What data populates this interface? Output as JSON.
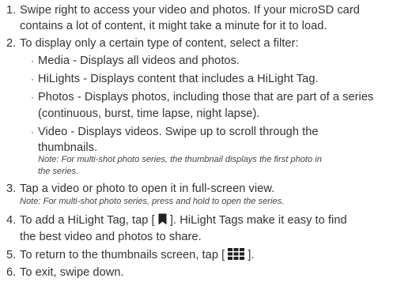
{
  "steps": [
    {
      "num": "1.",
      "lines": [
        "Swipe right to access your video and photos. If your microSD card",
        "contains a lot of content, it might take a minute for it to load."
      ]
    },
    {
      "num": "2.",
      "lines": [
        "To display only a certain type of content, select a filter:"
      ],
      "filters": [
        {
          "lines": [
            "Media - Displays all videos and photos."
          ]
        },
        {
          "lines": [
            "HiLights - Displays content that includes a HiLight Tag."
          ]
        },
        {
          "lines": [
            "Photos - Displays photos, including those that are part of a series",
            "(continuous, burst, time lapse, night lapse)."
          ]
        },
        {
          "lines": [
            "Video - Displays videos. Swipe up to scroll through the",
            "thumbnails."
          ],
          "note": [
            "Note: For multi-shot photo series, the thumbnail displays the first photo in",
            "the series."
          ]
        }
      ]
    },
    {
      "num": "3.",
      "lines": [
        "Tap a video or photo to open it in full-screen view."
      ],
      "note": [
        "Note: For multi-shot photo series, press and hold to open the series."
      ]
    },
    {
      "num": "4.",
      "line1_before": "To add a HiLight Tag, tap [",
      "line1_after": "]. HiLight Tags make it easy to find",
      "line2": "the best video and photos to share.",
      "icon": "hilight-tag-icon"
    },
    {
      "num": "5.",
      "line1_before": "To return to the thumbnails screen, tap [",
      "line1_after": "].",
      "icon": "thumbnail-grid-icon"
    },
    {
      "num": "6.",
      "lines": [
        "To exit, swipe down."
      ]
    }
  ],
  "colors": {
    "text": "#333333",
    "icon": "#222222"
  }
}
